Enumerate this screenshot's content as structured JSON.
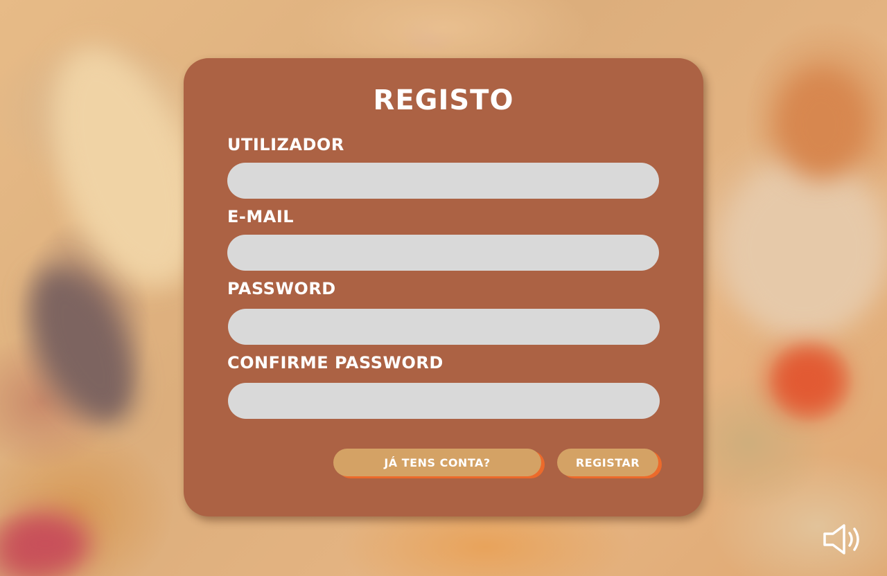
{
  "form": {
    "title": "REGISTO",
    "fields": [
      {
        "label": "UTILIZADOR",
        "value": "",
        "placeholder": ""
      },
      {
        "label": "E-MAIL",
        "value": "",
        "placeholder": ""
      },
      {
        "label": "PASSWORD",
        "value": "",
        "placeholder": ""
      },
      {
        "label": "CONFIRME PASSWORD",
        "value": "",
        "placeholder": ""
      }
    ],
    "login_link_label": "JÁ TENS CONTA?",
    "register_label": "REGISTAR"
  },
  "icons": {
    "sound": "speaker-volume-icon"
  },
  "colors": {
    "card": "#ac6244",
    "input": "#d9d9d9",
    "button": "#d4a265",
    "button_shadow": "#ec6a2b",
    "text": "#ffffff"
  }
}
